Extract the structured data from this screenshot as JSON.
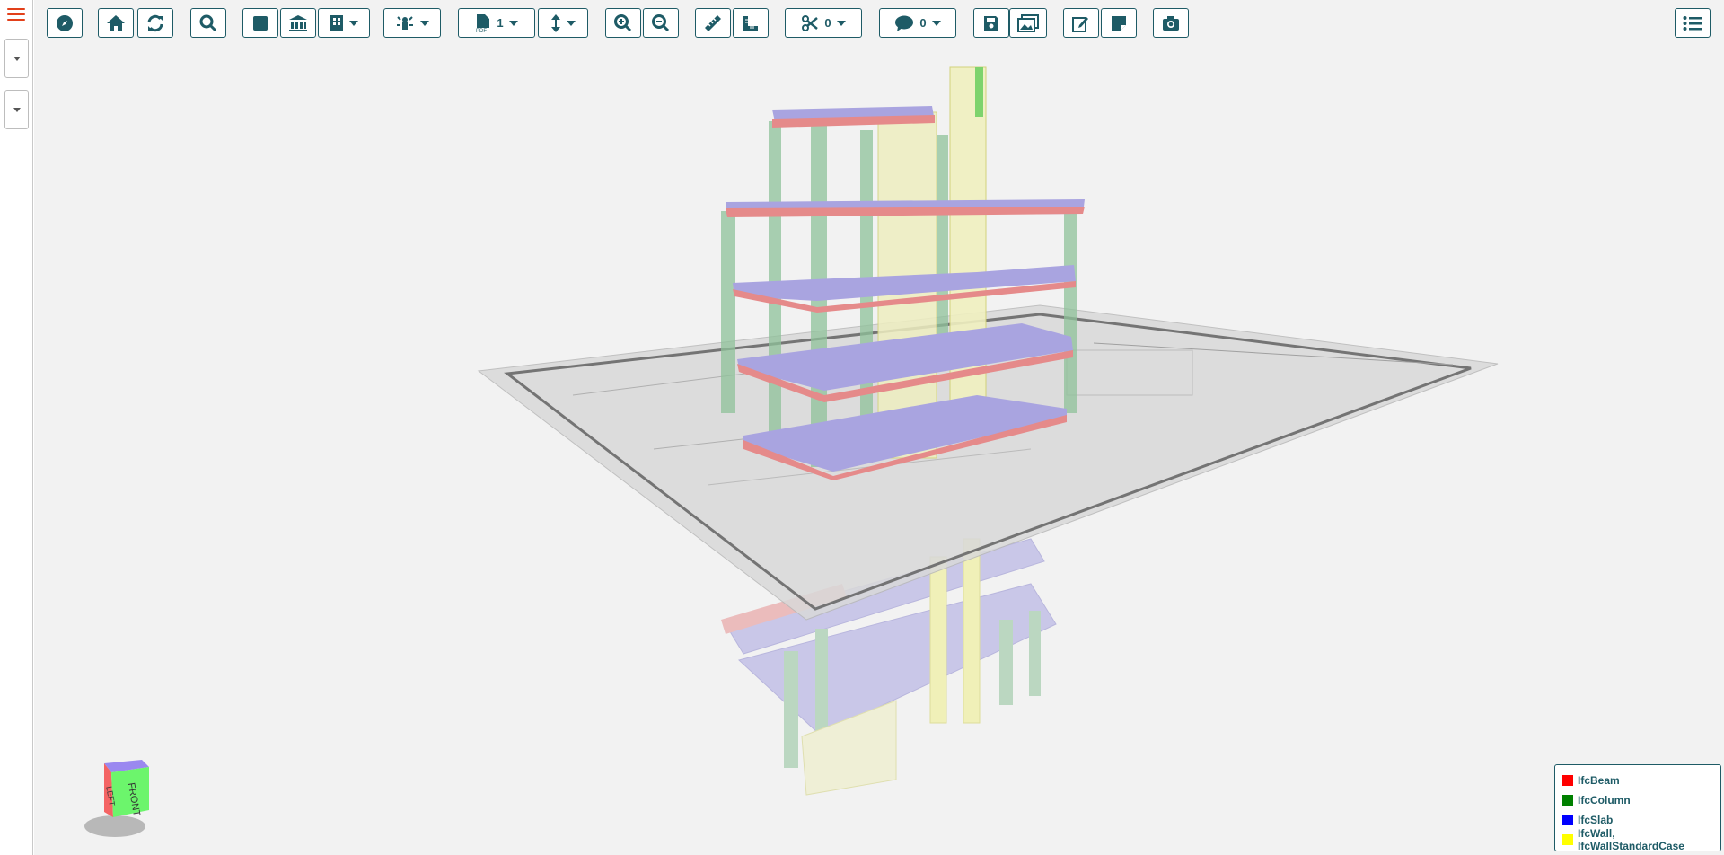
{
  "sidebar": {
    "menu_icon": "hamburger-menu-icon",
    "dropdowns": [
      {
        "icon": "caret-down-icon"
      },
      {
        "icon": "caret-down-icon"
      }
    ]
  },
  "toolbar": {
    "buttons": [
      {
        "name": "compass",
        "icon": "compass-icon"
      },
      {
        "name": "home",
        "icon": "home-icon"
      },
      {
        "name": "refresh",
        "icon": "refresh-icon"
      },
      {
        "name": "search",
        "icon": "search-icon"
      },
      {
        "name": "square",
        "icon": "square-icon"
      },
      {
        "name": "building-classic",
        "icon": "classical-building-icon"
      },
      {
        "name": "building-storey",
        "icon": "building-icon"
      },
      {
        "name": "lighting",
        "icon": "light-icon"
      },
      {
        "name": "pdf",
        "icon": "pdf-file-icon"
      },
      {
        "name": "height",
        "icon": "vertical-arrows-icon"
      },
      {
        "name": "zoom-in",
        "icon": "zoom-in-icon"
      },
      {
        "name": "zoom-out",
        "icon": "zoom-out-icon"
      },
      {
        "name": "ruler",
        "icon": "ruler-icon"
      },
      {
        "name": "angle-ruler",
        "icon": "angle-ruler-icon"
      },
      {
        "name": "scissors",
        "icon": "scissors-icon"
      },
      {
        "name": "comment",
        "icon": "comment-icon"
      },
      {
        "name": "save",
        "icon": "save-icon"
      },
      {
        "name": "images",
        "icon": "images-icon"
      },
      {
        "name": "edit",
        "icon": "edit-icon"
      },
      {
        "name": "sticky-note",
        "icon": "sticky-note-icon"
      },
      {
        "name": "camera",
        "icon": "camera-icon"
      },
      {
        "name": "list",
        "icon": "list-icon"
      }
    ],
    "pdf_page": "1",
    "section_count": "0",
    "comment_count": "0"
  },
  "legend": {
    "items": [
      {
        "label": "IfcBeam",
        "color": "#ff0000"
      },
      {
        "label": "IfcColumn",
        "color": "#008000"
      },
      {
        "label": "IfcSlab",
        "color": "#0000ff"
      },
      {
        "label": "IfcWall, IfcWallStandardCase",
        "color": "#ffff00"
      }
    ]
  },
  "navcube": {
    "faces": {
      "left": "LEFT",
      "front": "FRONT"
    },
    "colors": {
      "left": "#f46464",
      "front": "#6cf56c",
      "top": "#9a88f0"
    }
  },
  "colors": {
    "accent": "#1e5b66",
    "menu": "#e2401a",
    "viewport_bg": "#f2f2f2"
  }
}
